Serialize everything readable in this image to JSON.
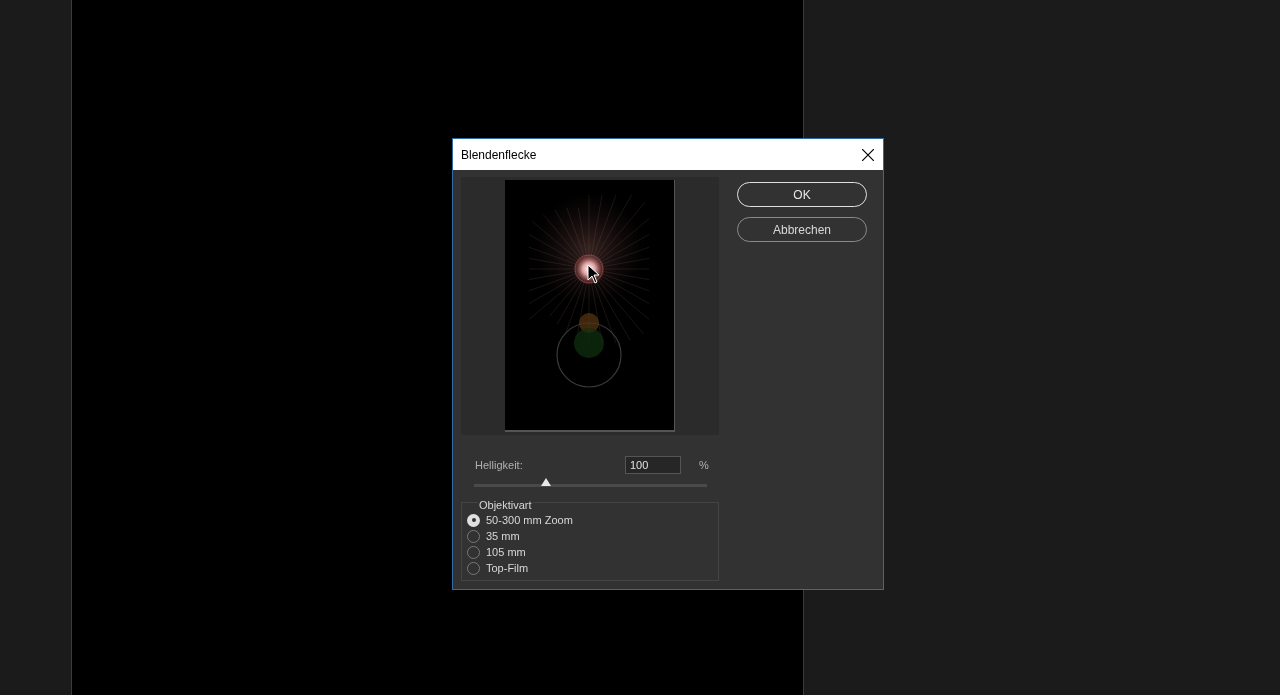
{
  "dialog": {
    "title": "Blendenflecke",
    "buttons": [
      {
        "label": "OK",
        "kind": "default"
      },
      {
        "label": "Abbrechen",
        "kind": "normal"
      }
    ],
    "brightness": {
      "label": "Helligkeit:",
      "value": "100",
      "unit": "%",
      "level": 0.31
    },
    "lens_type": {
      "legend": "Objektivart",
      "options": [
        {
          "label": "50-300 mm Zoom",
          "selected": true
        },
        {
          "label": "35 mm",
          "selected": false
        },
        {
          "label": "105 mm",
          "selected": false
        },
        {
          "label": "Top-Film",
          "selected": false
        }
      ]
    }
  }
}
